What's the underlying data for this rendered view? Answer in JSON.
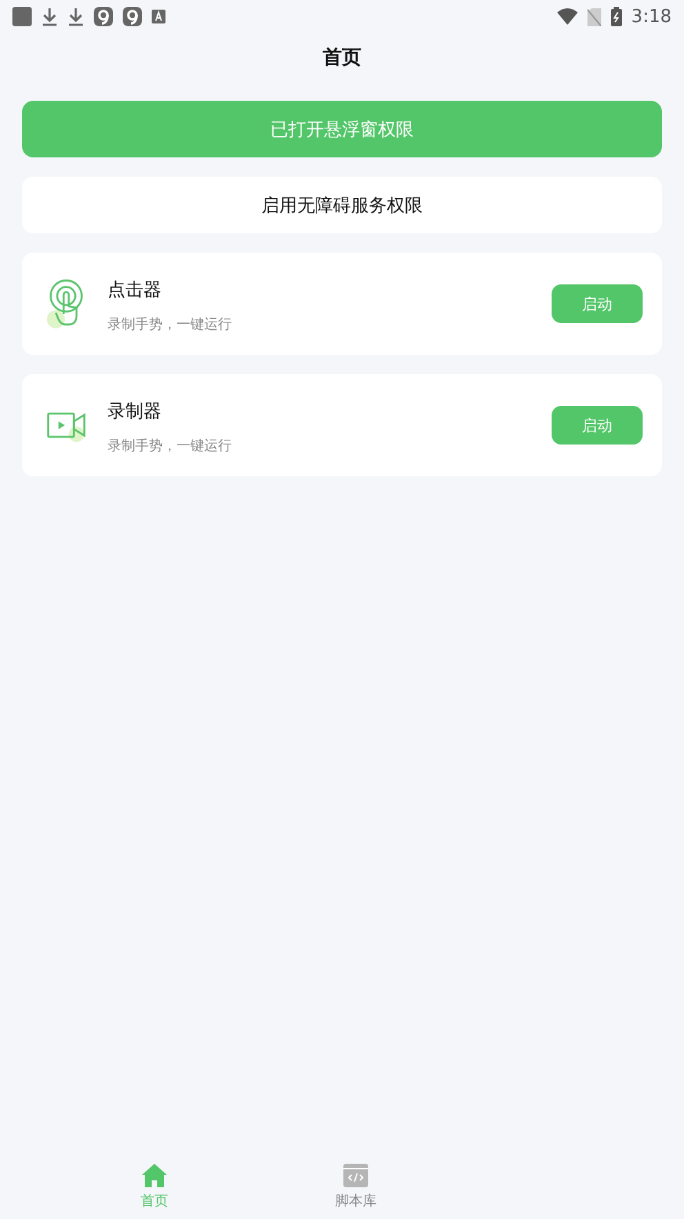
{
  "status_bar": {
    "time": "3:18"
  },
  "header": {
    "title": "首页"
  },
  "permissions": [
    {
      "label": "已打开悬浮窗权限",
      "granted": true
    },
    {
      "label": "启用无障碍服务权限",
      "granted": false
    }
  ],
  "tools": [
    {
      "kind": "clicker",
      "name": "点击器",
      "description": "录制手势，一键运行",
      "button": "启动"
    },
    {
      "kind": "recorder",
      "name": "录制器",
      "description": "录制手势，一键运行",
      "button": "启动"
    }
  ],
  "tabs": [
    {
      "kind": "home",
      "label": "首页",
      "selected": true
    },
    {
      "kind": "scripts",
      "label": "脚本库",
      "selected": false
    }
  ]
}
